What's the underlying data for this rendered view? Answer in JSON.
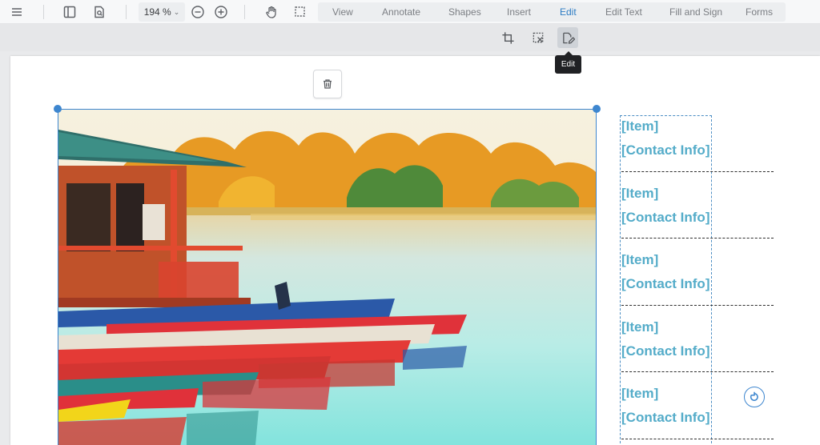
{
  "toolbar": {
    "zoom": "194 %",
    "modes": [
      "View",
      "Annotate",
      "Shapes",
      "Insert",
      "Edit",
      "Edit Text",
      "Fill and Sign",
      "Forms"
    ],
    "active_mode": "Edit"
  },
  "subbar": {
    "tooltip": "Edit"
  },
  "labels": [
    {
      "item": "[Item]",
      "contact": "[Contact Info]"
    },
    {
      "item": "[Item]",
      "contact": "[Contact Info]"
    },
    {
      "item": "[Item]",
      "contact": "[Contact Info]"
    },
    {
      "item": "[Item]",
      "contact": "[Contact Info]"
    },
    {
      "item": "[Item]",
      "contact": "[Contact Info]"
    }
  ],
  "colors": {
    "accent": "#2d7cc4",
    "selection": "#3d86cf",
    "label_text": "#54acc9"
  }
}
